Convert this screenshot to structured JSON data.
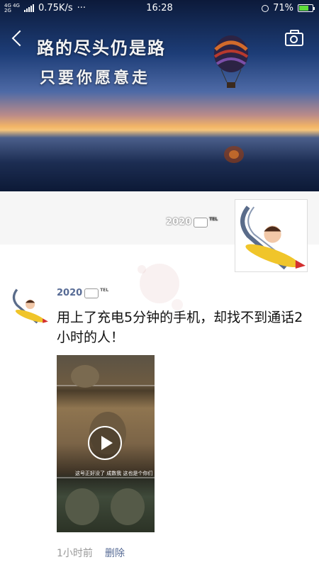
{
  "status_bar": {
    "network": "4G 4G",
    "network2": "2G",
    "speed": "0.75K/s",
    "more": "···",
    "time": "16:28",
    "battery": "71%",
    "battery_level": 0.71
  },
  "cover": {
    "line1": "路的尽头仍是路",
    "line2": "只要你愿意走"
  },
  "profile": {
    "nickname": "2020",
    "tel_label": "TEL"
  },
  "post": {
    "nickname": "2020",
    "tel_label": "TEL",
    "text": "用上了充电5分钟的手机，却找不到通话2小时的人！",
    "video_caption": "这号正好没了 成数我 这也是个你们",
    "time": "1小时前",
    "delete_label": "删除"
  },
  "colors": {
    "link": "#576b95",
    "battery_fill": "#5fdc3b"
  },
  "icons": [
    "back-icon",
    "camera-icon",
    "alarm-icon",
    "battery-icon",
    "play-icon"
  ]
}
